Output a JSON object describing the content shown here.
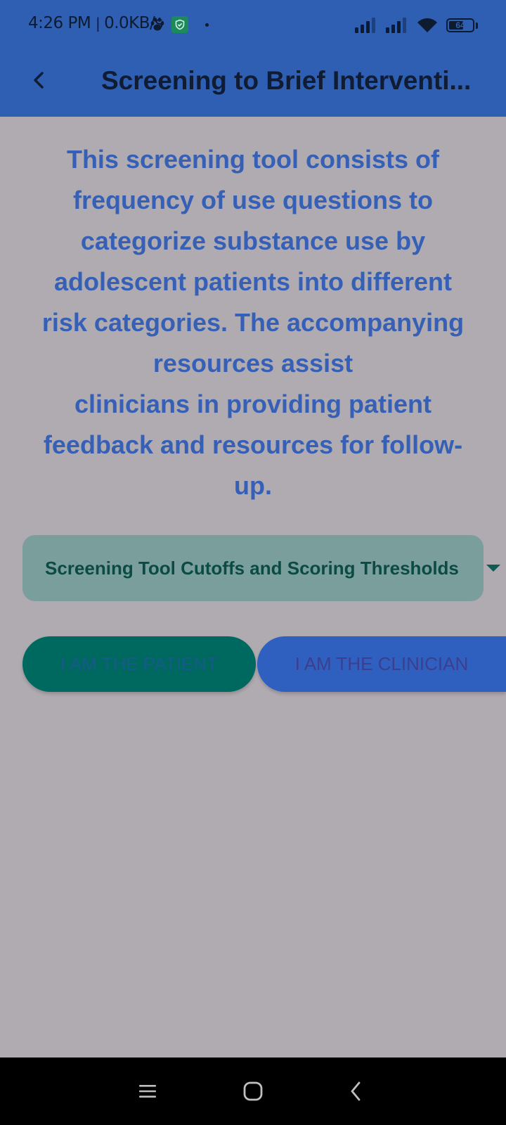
{
  "status_bar": {
    "time": "4:26 PM",
    "network_speed": "0.0KB/s",
    "battery_level": "64",
    "battery_fraction": 0.64,
    "icons": [
      "paw-icon",
      "shield-check-icon",
      "dot-icon",
      "signal-icon",
      "signal-icon",
      "wifi-icon",
      "battery-icon"
    ]
  },
  "app_bar": {
    "back_icon": "back-arrow-icon",
    "title": "Screening to Brief Interventi..."
  },
  "intro": {
    "lines": [
      "This screening tool consists of",
      "frequency of use questions to",
      "categorize substance use by",
      " adolescent patients into different",
      "risk categories. The accompanying",
      "resources assist",
      " clinicians in providing patient",
      "feedback and resources for follow-",
      "up."
    ]
  },
  "dropdown": {
    "label": "Screening Tool Cutoffs and Scoring Thresholds",
    "icon": "caret-down-icon"
  },
  "buttons": {
    "patient_label": "I AM THE PATIENT",
    "clinician_label": "I AM THE CLINICIAN"
  },
  "nav_bar": {
    "icons": [
      "menu-icon",
      "home-icon",
      "back-icon"
    ]
  },
  "colors": {
    "header": "#2f5fb3",
    "background": "#b0abb1",
    "intro_text": "#3660b6",
    "dropdown_bg": "#7a9e9c",
    "patient_button": "#00695f",
    "clinician_button": "#3060bf"
  }
}
